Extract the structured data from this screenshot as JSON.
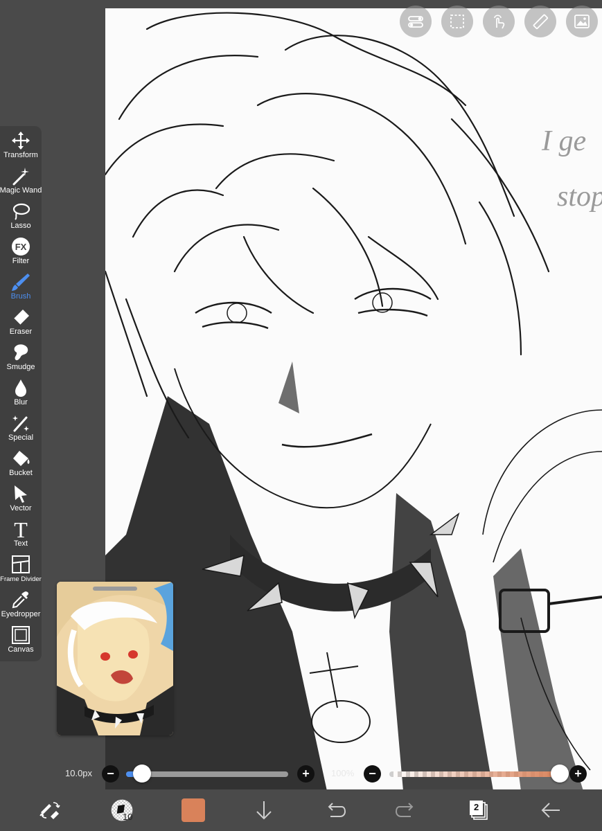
{
  "left_toolbar": {
    "tools": [
      {
        "label": "Transform",
        "icon": "transform-icon"
      },
      {
        "label": "Magic Wand",
        "icon": "magic-wand-icon"
      },
      {
        "label": "Lasso",
        "icon": "lasso-icon"
      },
      {
        "label": "Filter",
        "icon": "filter-fx-icon"
      },
      {
        "label": "Brush",
        "icon": "brush-icon",
        "active": true
      },
      {
        "label": "Eraser",
        "icon": "eraser-icon"
      },
      {
        "label": "Smudge",
        "icon": "smudge-icon"
      },
      {
        "label": "Blur",
        "icon": "blur-drop-icon"
      },
      {
        "label": "Special",
        "icon": "special-icon"
      },
      {
        "label": "Bucket",
        "icon": "bucket-icon"
      },
      {
        "label": "Vector",
        "icon": "vector-arrow-icon"
      },
      {
        "label": "Text",
        "icon": "text-icon"
      },
      {
        "label": "Frame Divider",
        "icon": "frame-divider-icon"
      },
      {
        "label": "Eyedropper",
        "icon": "eyedropper-icon"
      },
      {
        "label": "Canvas",
        "icon": "canvas-icon"
      }
    ],
    "filter_glyph": "FX",
    "text_glyph": "T"
  },
  "top_tools": [
    "layer-toggle-icon",
    "selection-icon",
    "touch-icon",
    "ruler-icon",
    "image-icon"
  ],
  "sliders": {
    "brush_size": {
      "value_text": "10.0px",
      "fraction": 0.1
    },
    "opacity": {
      "value_text": "100%",
      "fraction": 1.0
    },
    "minus_label": "−",
    "plus_label": "+"
  },
  "bottom_bar": {
    "brush_size_badge": "10",
    "color": "#d9825a",
    "layer_count": "2"
  },
  "canvas": {
    "handwritten_note_line1": "I ge",
    "handwritten_note_line2": "stop"
  },
  "colors": {
    "accent": "#4d8ff0",
    "toolbar_bg": "#3f3f3f",
    "canvas_bg": "#fbfbfb",
    "opacity_track": "#d9825a"
  }
}
